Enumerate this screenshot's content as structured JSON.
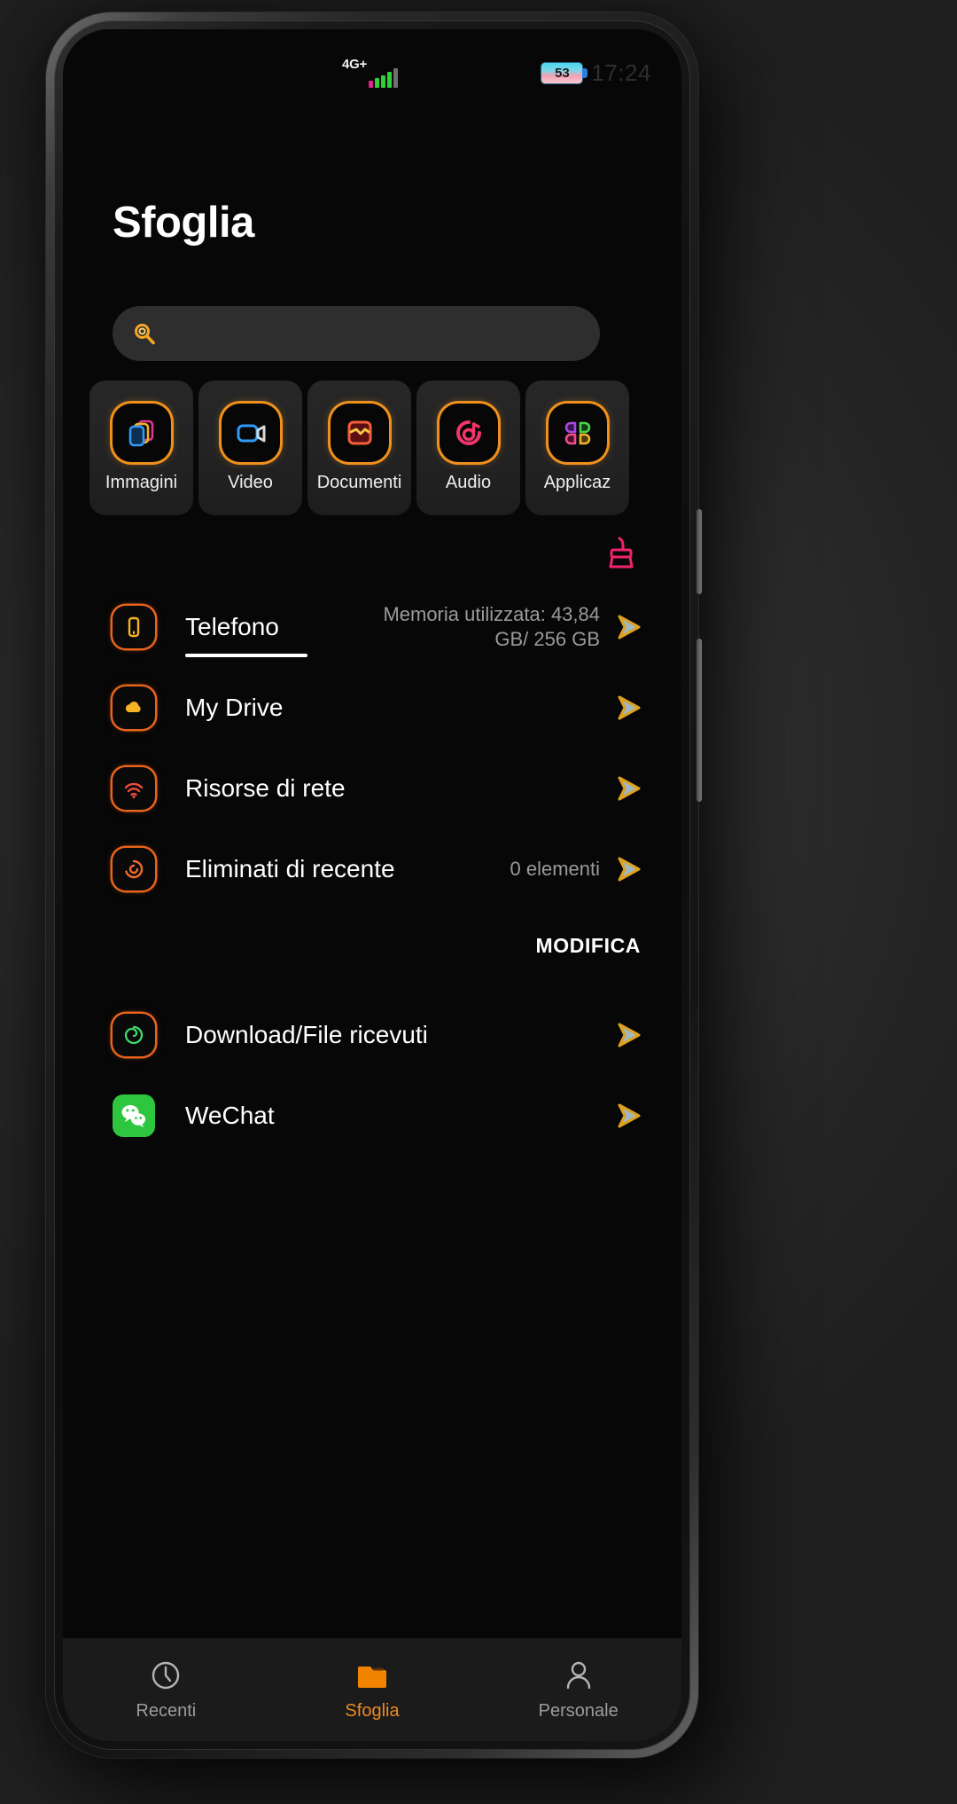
{
  "status_bar": {
    "network_label": "4G+",
    "signal_icon": "signal-bars-icon",
    "battery_percent": "53",
    "battery_icon": "battery-icon",
    "time": "17:24"
  },
  "header": {
    "title": "Sfoglia"
  },
  "search": {
    "icon": "search-icon",
    "value": "",
    "placeholder": ""
  },
  "categories": [
    {
      "label": "Immagini",
      "icon": "images-icon"
    },
    {
      "label": "Video",
      "icon": "video-camera-icon"
    },
    {
      "label": "Documenti",
      "icon": "document-icon"
    },
    {
      "label": "Audio",
      "icon": "music-note-icon"
    },
    {
      "label": "Applicaz",
      "icon": "apps-grid-icon"
    }
  ],
  "clean_button": {
    "icon": "broom-icon"
  },
  "storage_list": [
    {
      "name": "Telefono",
      "meta": "Memoria utilizzata: 43,84 GB/ 256 GB",
      "icon": "phone-storage-icon",
      "chevron": "chevron-right-icon",
      "active": true
    },
    {
      "name": "My Drive",
      "meta": "",
      "icon": "cloud-icon",
      "chevron": "chevron-right-icon",
      "active": false
    },
    {
      "name": "Risorse di rete",
      "meta": "",
      "icon": "network-icon",
      "chevron": "chevron-right-icon",
      "active": false
    },
    {
      "name": "Eliminati di recente",
      "meta": "0 elementi",
      "icon": "recycle-bin-icon",
      "chevron": "chevron-right-icon",
      "active": false
    }
  ],
  "section": {
    "edit_label": "MODIFICA"
  },
  "shortcut_list": [
    {
      "name": "Download/File ricevuti",
      "icon": "download-spiral-icon",
      "chevron": "chevron-right-icon"
    },
    {
      "name": "WeChat",
      "icon": "wechat-icon",
      "chevron": "chevron-right-icon"
    }
  ],
  "bottom_nav": [
    {
      "label": "Recenti",
      "icon": "clock-icon",
      "active": false
    },
    {
      "label": "Sfoglia",
      "icon": "folder-icon",
      "active": true
    },
    {
      "label": "Personale",
      "icon": "person-icon",
      "active": false
    }
  ],
  "colors": {
    "accent": "#ef8a1f",
    "icon_ring": "#e8631b",
    "background": "#070707",
    "nav_background": "#1b1b1b",
    "muted_text": "#9a9a9a"
  }
}
